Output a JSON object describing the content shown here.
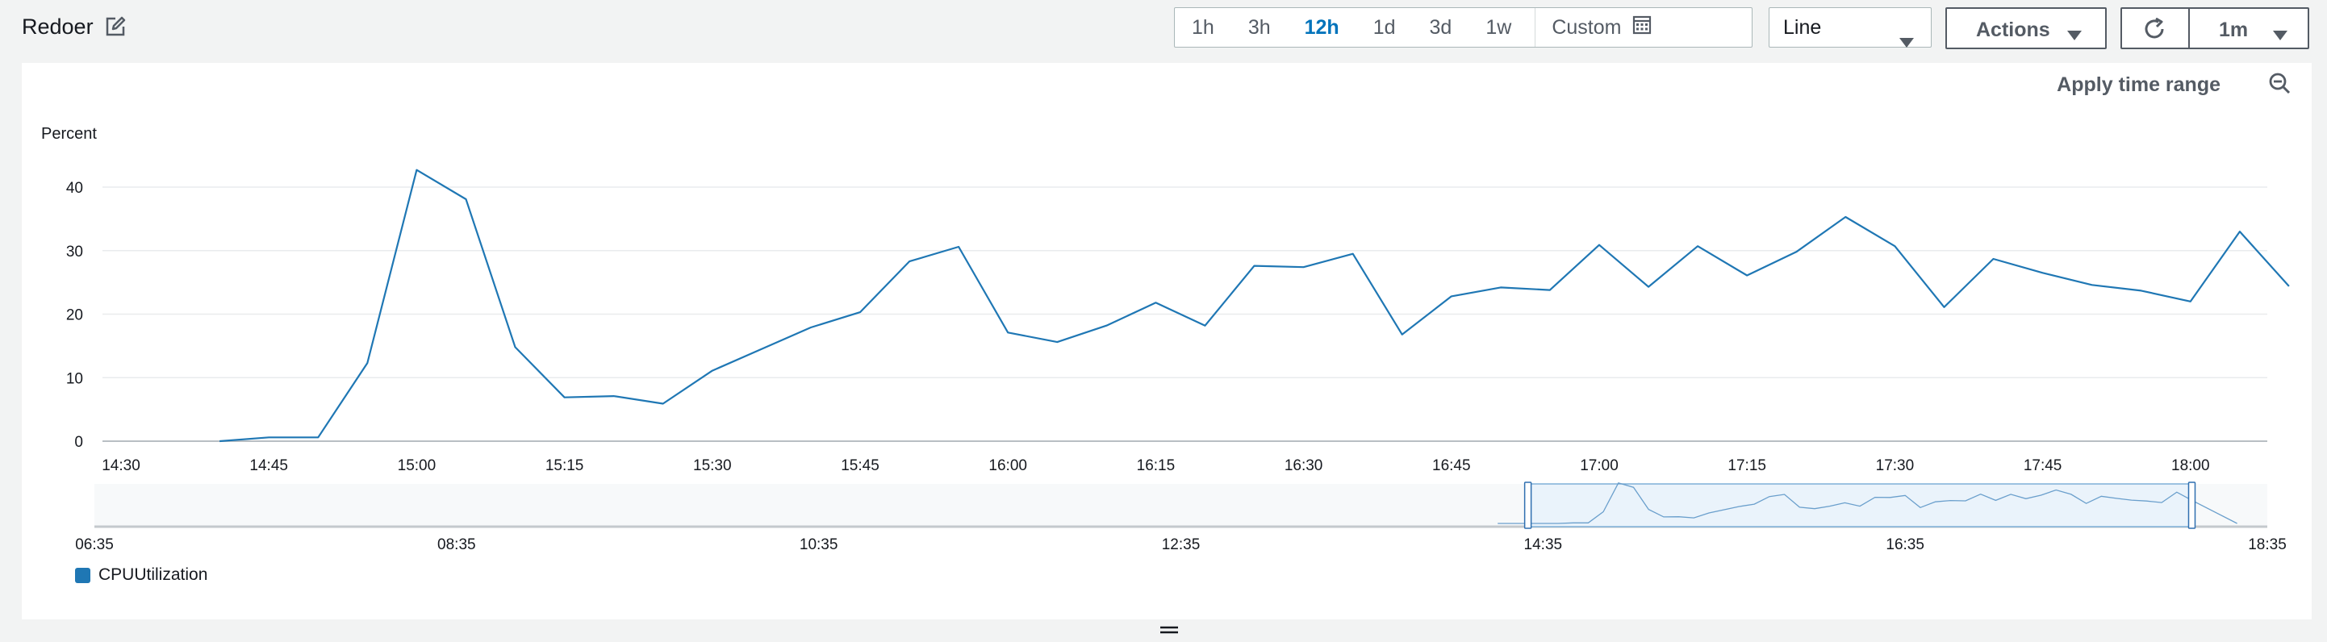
{
  "header": {
    "title": "Redoer",
    "time_ranges": [
      "1h",
      "3h",
      "12h",
      "1d",
      "3d",
      "1w"
    ],
    "active_range": "12h",
    "custom_label": "Custom",
    "chart_type": "Line",
    "actions_label": "Actions",
    "refresh_interval": "1m"
  },
  "panel": {
    "apply_label": "Apply time range",
    "legend_label": "CPUUtilization"
  },
  "colors": {
    "line": "#1f77b4",
    "accent": "#0073bb"
  },
  "chart_data": {
    "type": "line",
    "ylabel": "Percent",
    "ylim": [
      0,
      40
    ],
    "yticks": [
      0,
      10,
      20,
      30,
      40
    ],
    "xticks": [
      "14:30",
      "14:45",
      "15:00",
      "15:15",
      "15:30",
      "15:45",
      "16:00",
      "16:15",
      "16:30",
      "16:45",
      "17:00",
      "17:15",
      "17:30",
      "17:45",
      "18:00"
    ],
    "series": [
      {
        "name": "CPUUtilization",
        "x": [
          "14:40",
          "14:45",
          "14:50",
          "14:55",
          "15:00",
          "15:05",
          "15:10",
          "15:15",
          "15:20",
          "15:25",
          "15:30",
          "15:35",
          "15:40",
          "15:45",
          "15:50",
          "15:55",
          "16:00",
          "16:05",
          "16:10",
          "16:15",
          "16:20",
          "16:25",
          "16:30",
          "16:35",
          "16:40",
          "16:45",
          "16:50",
          "16:55",
          "17:00",
          "17:05",
          "17:10",
          "17:15",
          "17:20",
          "17:25",
          "17:30",
          "17:35",
          "17:40",
          "17:45",
          "17:50",
          "17:55",
          "18:00",
          "18:05",
          "18:10"
        ],
        "values": [
          0,
          0.6,
          0.6,
          12.3,
          42.7,
          38.1,
          14.8,
          6.9,
          7.1,
          5.9,
          11.1,
          14.5,
          17.9,
          20.3,
          28.3,
          30.6,
          17.1,
          15.6,
          18.2,
          21.8,
          18.2,
          27.6,
          27.4,
          29.5,
          16.8,
          22.8,
          24.2,
          23.8,
          30.9,
          24.3,
          30.7,
          26.1,
          29.8,
          35.3,
          30.7,
          21.1,
          28.7,
          26.5,
          24.6,
          23.7,
          22.0,
          33.0,
          24.4
        ]
      }
    ],
    "overview": {
      "ticks": [
        "06:35",
        "08:35",
        "10:35",
        "12:35",
        "14:35",
        "16:35",
        "18:35"
      ],
      "selection": [
        "14:30",
        "18:10"
      ]
    }
  }
}
